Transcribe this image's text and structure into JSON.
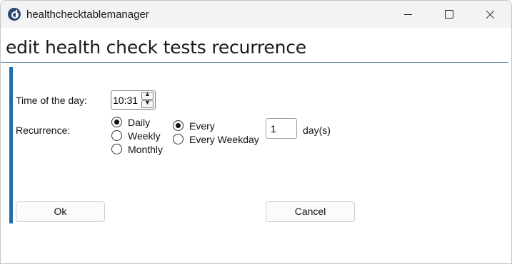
{
  "window": {
    "title": "healthchecktablemanager"
  },
  "page": {
    "heading": "edit health check tests recurrence"
  },
  "form": {
    "time_label": "Time of the day:",
    "time_value": "10:31",
    "recurrence_label": "Recurrence:",
    "frequency_options": [
      {
        "label": "Daily",
        "checked": true
      },
      {
        "label": "Weekly",
        "checked": false
      },
      {
        "label": "Monthly",
        "checked": false
      }
    ],
    "daily_options": [
      {
        "label": "Every",
        "checked": true
      },
      {
        "label": "Every Weekday",
        "checked": false
      }
    ],
    "every_days_value": "1",
    "days_unit": "day(s)"
  },
  "buttons": {
    "ok_label": "Ok",
    "cancel_label": "Cancel"
  },
  "colors": {
    "accent": "#1f6fae",
    "heading_rule": "#2a6e9c"
  },
  "icons": {
    "app": "app-logo-icon",
    "minimize": "minimize-icon",
    "maximize": "maximize-icon",
    "close": "close-icon",
    "spin_up": "chevron-up-icon",
    "spin_down": "chevron-down-icon"
  }
}
